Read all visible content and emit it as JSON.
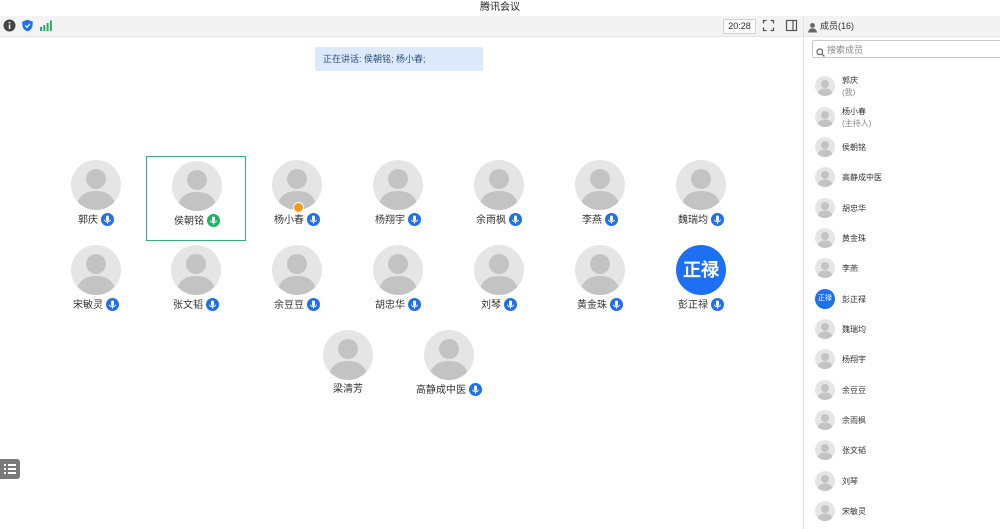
{
  "window": {
    "title": "腾讯会议"
  },
  "toolbar": {
    "time": "20:28"
  },
  "speaking": {
    "text": "正在讲话: 侯朝铭; 杨小春;"
  },
  "grid": [
    {
      "name": "郭庆",
      "mic": "blue"
    },
    {
      "name": "侯朝铭",
      "mic": "green",
      "active": true
    },
    {
      "name": "杨小春",
      "mic": "blue",
      "host": true
    },
    {
      "name": "杨翔宇",
      "mic": "blue"
    },
    {
      "name": "余雨枫",
      "mic": "blue"
    },
    {
      "name": "李燕",
      "mic": "blue"
    },
    {
      "name": "魏瑞均",
      "mic": "blue"
    },
    {
      "name": "宋敏灵",
      "mic": "blue"
    },
    {
      "name": "张文韬",
      "mic": "blue"
    },
    {
      "name": "余豆豆",
      "mic": "blue"
    },
    {
      "name": "胡忠华",
      "mic": "blue"
    },
    {
      "name": "刘琴",
      "mic": "blue"
    },
    {
      "name": "黄金珠",
      "mic": "blue"
    },
    {
      "name": "彭正禄",
      "mic": "blue",
      "avatar_text": "正禄"
    },
    {
      "name": "梁清芳",
      "mic": "none"
    },
    {
      "name": "高静成中医",
      "mic": "blue"
    }
  ],
  "panel": {
    "title": "成员(16)",
    "search_placeholder": "搜索成员",
    "members": [
      {
        "name": "郭庆",
        "role": "(我)"
      },
      {
        "name": "杨小春",
        "role": "(主持人)"
      },
      {
        "name": "侯朝铭"
      },
      {
        "name": "高静成中医"
      },
      {
        "name": "胡忠华"
      },
      {
        "name": "黄金珠"
      },
      {
        "name": "李燕"
      },
      {
        "name": "彭正禄",
        "avatar_text": "正禄"
      },
      {
        "name": "魏瑞均"
      },
      {
        "name": "杨翔宇"
      },
      {
        "name": "余豆豆"
      },
      {
        "name": "余雨枫"
      },
      {
        "name": "张文韬"
      },
      {
        "name": "刘琴"
      },
      {
        "name": "宋敏灵"
      }
    ]
  },
  "colors": {
    "accent": "#1e6ff1",
    "speaking_mic": "#22b062",
    "active_border": "#3aae72",
    "host_badge": "#f19a1d"
  },
  "icons": [
    "info-icon",
    "shield-icon",
    "signal-icon",
    "fullscreen-icon",
    "sidebar-icon",
    "user-icon",
    "search-icon",
    "mic-icon",
    "list-icon"
  ]
}
